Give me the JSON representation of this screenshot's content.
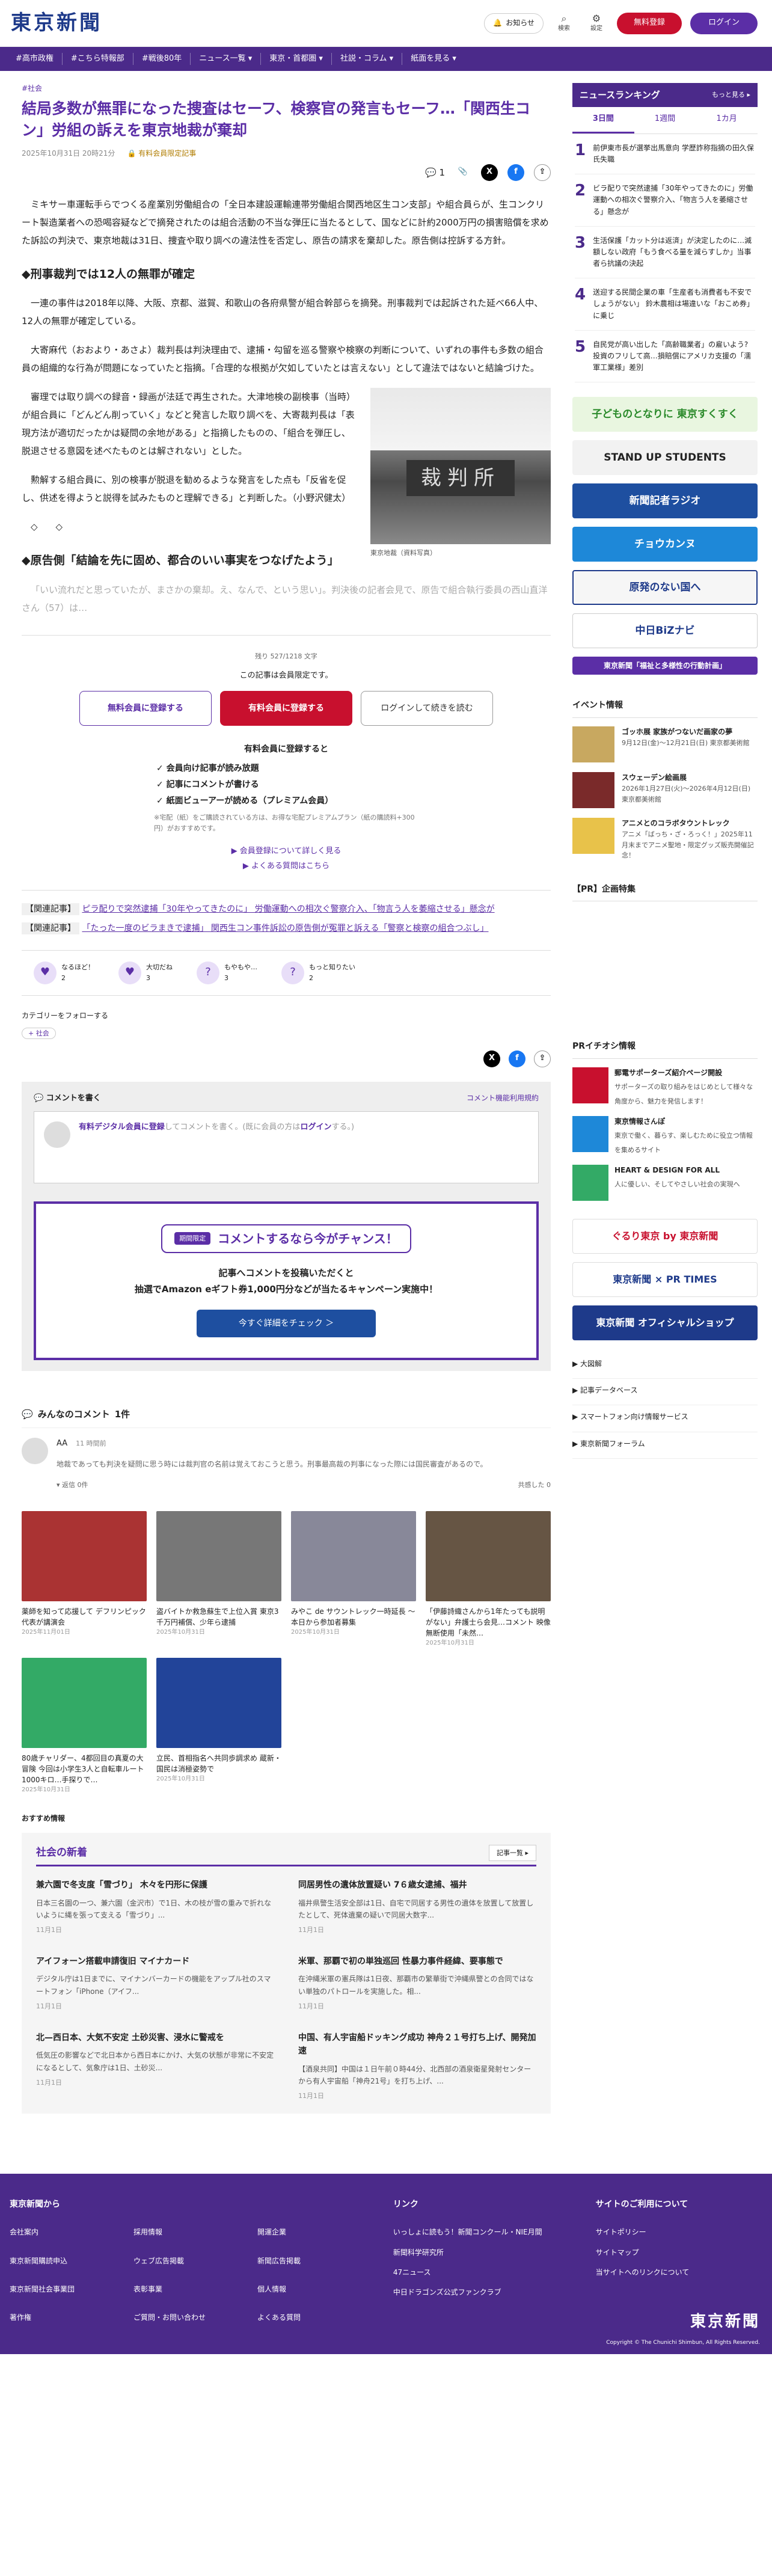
{
  "header": {
    "logo": "東京新聞",
    "notice": "お知らせ",
    "search": "検索",
    "settings": "設定",
    "free_register": "無料登録",
    "login": "ログイン"
  },
  "nav": [
    "#高市政権",
    "#こちら特報部",
    "#戦後80年",
    "ニュース一覧 ▾",
    "東京・首都圏 ▾",
    "社説・コラム ▾",
    "紙面を見る ▾"
  ],
  "article": {
    "tag": "#社会",
    "title": "結局多数が無罪になった捜査はセーフ、検察官の発言もセーフ…「関西生コン」労組の訴えを東京地裁が棄却",
    "date": "2025年10月31日 20時21分",
    "member": "有料会員限定記事",
    "comment_count": "1",
    "paragraphs": [
      "ミキサー車運転手らでつくる産業別労働組合の「全日本建設運輸連帯労働組合関西地区生コン支部」や組合員らが、生コンクリート製造業者への恐喝容疑などで摘発されたのは組合活動の不当な弾圧に当たるとして、国などに計約2000万円の損害賠償を求めた訴訟の判決で、東京地裁は31日、捜査や取り調べの違法性を否定し、原告の請求を棄却した。原告側は控訴する方針。"
    ],
    "h2_1": "◆刑事裁判では12人の無罪が確定",
    "paragraphs2": [
      "一連の事件は2018年以降、大阪、京都、滋賀、和歌山の各府県警が組合幹部らを摘発。刑事裁判では起訴された延べ66人中、12人の無罪が確定している。",
      "大寄麻代（おおより・あさよ）裁判長は判決理由で、逮捕・勾留を巡る警察や検察の判断について、いずれの事件も多数の組合員の組織的な行為が問題になっていたと指摘。「合理的な根拠が欠如していたとは言えない」として違法ではないと結論づけた。",
      "審理では取り調べの録音・録画が法廷で再生された。大津地検の副検事（当時）が組合員に「どんどん削っていく」などと発言した取り調べを、大寄裁判長は「表現方法が適切だったかは疑問の余地がある」と指摘したものの、「組合を弾圧し、脱退させる意図を述べたものとは解されない」とした。",
      "勲解する組合員に、別の検事が脱退を勧めるような発言をした点も「反省を促し、供述を得ようと説得を試みたものと理解できる」と判断した。（小野沢健太）"
    ],
    "photo_caption": "東京地裁（資料写真）",
    "photo_sign": "裁判所",
    "dots": "◇　　◇",
    "h2_2": "◆原告側「結論を先に固め、都合のいい事実をつなげたよう」",
    "fade": "「いい流れだと思っていたが、まさかの棄却。え、なんで、という思い」。判決後の記者会見で、原告で組合執行委員の西山直洋さん（57）は…"
  },
  "paywall": {
    "remain": "残り 527/1218 文字",
    "note": "この記事は会員限定です。",
    "btn_free": "無料会員に登録する",
    "btn_paid": "有料会員に登録する",
    "btn_login": "ログインして続きを読む",
    "benefit_title": "有料会員に登録すると",
    "benefits": [
      "✓ 会員向け記事が読み放題",
      "✓ 記事にコメントが書ける",
      "✓ 紙面ビューアーが読める（プレミアム会員）"
    ],
    "small": "※宅配（紙）をご購読されている方は、お得な宅配プレミアムプラン（紙の購読料+300円）がおすすめです。",
    "link1": "▶ 会員登録について詳しく見る",
    "link2": "▶ よくある質問はこちら"
  },
  "related": [
    {
      "label": "【関連記事】",
      "text": "ピラ配りで突然逮捕「30年やってきたのに」 労働運動への相次ぐ警察介入、「物言う人を萎縮させる」懸念が"
    },
    {
      "label": "【関連記事】",
      "text": "「たった一度のビラまきで逮捕」 関西生コン事件訴訟の原告側が冤罪と訴える「警察と検察の組合つぶし」"
    }
  ],
  "reactions": [
    {
      "icon": "♥",
      "label": "なるほど！",
      "count": "2"
    },
    {
      "icon": "♥",
      "label": "大切だね",
      "count": "3"
    },
    {
      "icon": "?",
      "label": "もやもや…",
      "count": "3"
    },
    {
      "icon": "?",
      "label": "もっと知りたい",
      "count": "2"
    }
  ],
  "follow": {
    "label": "カテゴリーをフォローする",
    "chip": "+ 社会"
  },
  "comment_box": {
    "title": "コメントを書く",
    "policy": "コメント機能利用規約",
    "paid": "有料デジタル会員に登録",
    "placeholder_mid": "してコメントを書く。(既に会員の方は",
    "login": "ログイン",
    "end": "する。)"
  },
  "campaign": {
    "limited": "期間限定",
    "title": "コメントするなら今がチャンス！",
    "line1": "記事へコメントを投稿いただくと",
    "line2": "抽選でAmazon eギフト券1,000円分などが当たるキャンペーン実施中！",
    "btn": "今すぐ詳細をチェック ＞"
  },
  "comments_sec": {
    "title": "みんなのコメント",
    "count": "1件",
    "name": "AA",
    "time": "11 時間前",
    "text": "地裁であっても判決を疑問に思う時には裁判官の名前は覚えておこうと思う。刑事最高裁の判事になった際には国民審査があるので。",
    "reply": "▾ 返信 0件",
    "like": "共感した 0"
  },
  "grid": [
    {
      "t": "薬師を知って応援して デフリンピック代表が講演会",
      "d": "2025年11月01日",
      "c": "#a33"
    },
    {
      "t": "盗バイトか救急蘇生で上位入賞 東京3千万円補償、少年ら逮捕",
      "d": "2025年10月31日",
      "c": "#777"
    },
    {
      "t": "みやこ de サウントレック一時延長 ～ 本日から参加者募集",
      "d": "2025年10月31日",
      "c": "#889"
    },
    {
      "t": "「伊藤詩織さんから1年たっても説明がない」弁護士ら会見…コメント 映像無断使用「未然…",
      "d": "2025年10月31日",
      "c": "#654"
    },
    {
      "t": "80歳チャリダー、4都回目の真夏の大冒険 今回は小学生3人と自転車ルート1000キロ…手探りで…",
      "d": "2025年10月31日",
      "c": "#3a6"
    },
    {
      "t": "立民、首相指名へ共同歩調求め 蔵新・国民は消極姿勢で",
      "d": "2025年10月31日",
      "c": "#249"
    }
  ],
  "recos": "おすすめ情報",
  "latest": {
    "title": "社会の新着",
    "more": "記事一覧 ▸",
    "items": [
      {
        "t": "兼六園で冬支度「雪づり」 木々を円形に保護",
        "p": "日本三名園の一つ、兼六園（金沢市）で1日、木の枝が雪の重みで折れないように縄を張って支える「雪づり」...",
        "d": "11月1日"
      },
      {
        "t": "同居男性の遺体放置疑い 7６歳女逮捕、福井",
        "p": "福井県警生活安全部は1日、自宅で同居する男性の遺体を放置して放置したとして、死体遺棄の疑いで同居大数字...",
        "d": "11月1日"
      },
      {
        "t": "アイフォーン搭載申請復旧 マイナカード",
        "p": "デジタル庁は1日までに、マイナンバーカードの機能をアップル社のスマートフォン「iPhone（アイフ...",
        "d": "11月1日"
      },
      {
        "t": "米軍、那覇で初の単独巡回 性暴力事件経緯、要事態で",
        "p": "在沖縄米軍の憲兵隊は1日夜、那覇市の繁華街で沖縄県警との合同ではない単独のパトロールを実施した。相...",
        "d": "11月1日"
      },
      {
        "t": "北—西日本、大気不安定 土砂災害、浸水に警戒を",
        "p": "低気圧の影響などで北日本から西日本にかけ、大気の状態が非常に不安定になるとして、気象庁は1日、土砂災...",
        "d": "11月1日"
      },
      {
        "t": "中国、有人宇宙船ドッキング成功 神舟２１号打ち上げ、開発加速",
        "p": "【酒泉共同】中国は１日午前０時44分、北西部の酒泉衛星発射センターから有人宇宙船「神舟21号」を打ち上げ、...",
        "d": "11月1日"
      }
    ]
  },
  "side": {
    "rank_title": "ニュースランキング",
    "rank_more": "もっと見る ▸",
    "tabs": [
      "3日間",
      "1週間",
      "1カ月"
    ],
    "ranks": [
      "前伊東市長が選挙出馬意向 学歴詐称指摘の田久保氏失職",
      "ビラ配りで突然逮捕「30年やってきたのに」労働運動への相次ぐ警察介入、「物言う人を萎縮させる」懸念が",
      "生活保護「カット分は返済」が決定したのに…減額しない政府「もう食べる量を減らすしか」当事者ら抗議の決起",
      "送迎する民間企業の車「生産者も消費者も不安でしょうがない」 鈴木農相は場違いな「おこめ券」に乗じ",
      "自民党が高い出した「高齢職業者」の雇いよう? 投資のフリして高…損賠償にアメリカ支援の「濡軍工業様」差別"
    ],
    "banners": [
      {
        "t": "子どものとなりに 東京すくすく",
        "bg": "#e9f6e0",
        "c": "#2a8a2a"
      },
      {
        "t": "STAND UP STUDENTS",
        "bg": "#f2f2f2",
        "c": "#222"
      },
      {
        "t": "新聞記者ラジオ",
        "bg": "#1e4fa0",
        "c": "#fff"
      },
      {
        "t": "チョウカンヌ",
        "bg": "#1e88d8",
        "c": "#fff"
      },
      {
        "t": "原発のない国へ",
        "bg": "#f6f6f6",
        "c": "#1e3a8a"
      },
      {
        "t": "中日BiZナビ",
        "bg": "#fff",
        "c": "#1e3a8a"
      },
      {
        "t": "東京新聞「福祉と多様性の行動計画」",
        "bg": "#5b2ea6",
        "c": "#fff"
      }
    ],
    "events_title": "イベント情報",
    "events": [
      {
        "t": "ゴッホ展 家族がつないだ画家の夢",
        "s": "9月12日(金)～12月21日(日) 東京都美術館",
        "c": "#c8a860"
      },
      {
        "t": "スウェーデン絵画展",
        "s": "2026年1月27日(火)～2026年4月12日(日) 東京都美術館",
        "c": "#7a2a2a"
      },
      {
        "t": "アニメとのコラボタウントレック",
        "s": "アニメ「ばっち・ざ・ろっく！」2025年11月末までアニメ聖地・限定グッズ販売開催記念！",
        "c": "#e8c24a"
      }
    ],
    "pr_title": "【PR】企画特集",
    "prichi_title": "PRイチオシ情報",
    "prichi": [
      {
        "t": "郵電サポーターズ紹介ページ開設",
        "s": "サポーターズの取り組みをはじめとして様々な角度から、魅力を発信します！",
        "c": "#c8102e"
      },
      {
        "t": "東京情報さんぽ",
        "s": "東京で働く、暮らす、楽しむために役立つ情報を集めるサイト",
        "c": "#1e88d8"
      },
      {
        "t": "HEART & DESIGN FOR ALL",
        "s": "人に優しい、そしてやさしい社会の実現へ",
        "c": "#3a6"
      }
    ],
    "big_banners": [
      {
        "t": "ぐるり東京 by 東京新聞",
        "bg": "#fff",
        "c": "#c8102e"
      },
      {
        "t": "東京新聞 × PR TIMES",
        "bg": "#fff",
        "c": "#1e3a8a"
      },
      {
        "t": "東京新聞 オフィシャルショップ",
        "bg": "#1e3a8a",
        "c": "#fff"
      }
    ],
    "slist": [
      "▶ 大図解",
      "▶ 記事データベース",
      "▶ スマートフォン向け情報サービス",
      "▶ 東京新聞フォーラム"
    ]
  },
  "footer": {
    "c1": "東京新聞から",
    "c1items": [
      "会社案内",
      "採用情報",
      "開運企業",
      "東京新聞購読申込",
      "ウェブ広告掲載",
      "新聞広告掲載",
      "東京新聞社会事業団",
      "表彰事業",
      "個人情報",
      "著作権",
      "ご質問・お問い合わせ",
      "よくある質問"
    ],
    "c2": "リンク",
    "c2items": [
      "いっしょに読もう！新聞コンクール・NIE月間",
      "新聞科学研究所",
      "47ニュース",
      "中日ドラゴンズ公式ファンクラブ"
    ],
    "c3": "サイトのご利用について",
    "c3items": [
      "サイトポリシー",
      "サイトマップ",
      "当サイトへのリンクについて"
    ],
    "logo": "東京新聞",
    "copy": "Copyright © The Chunichi Shimbun, All Rights Reserved."
  }
}
